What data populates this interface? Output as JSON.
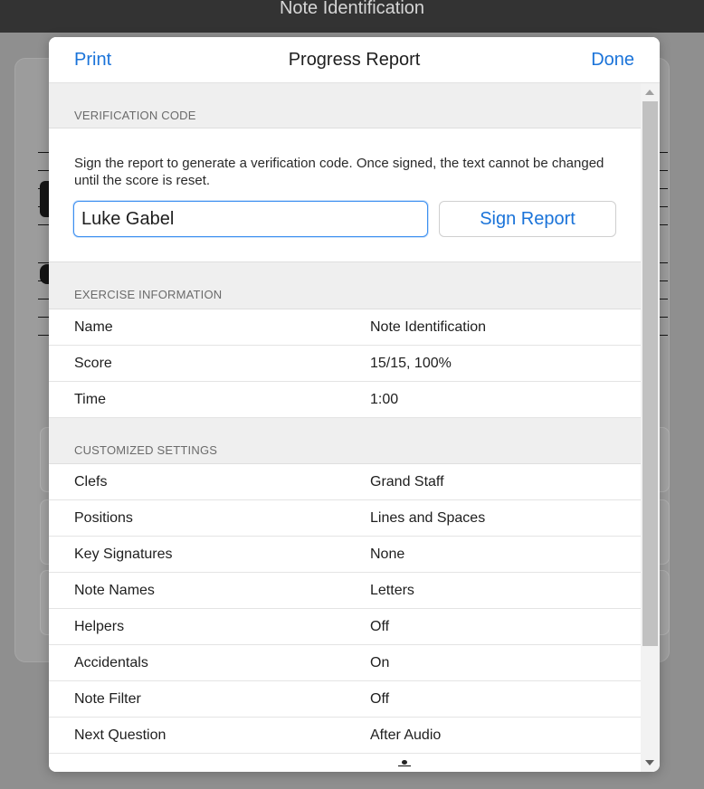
{
  "app": {
    "title": "Note Identification"
  },
  "modal": {
    "print_label": "Print",
    "title": "Progress Report",
    "done_label": "Done"
  },
  "verification": {
    "section_label": "VERIFICATION CODE",
    "instructions": "Sign the report to generate a verification code. Once signed, the text cannot be changed until the score is reset.",
    "name_value": "Luke Gabel",
    "sign_button": "Sign Report"
  },
  "exercise": {
    "section_label": "EXERCISE INFORMATION",
    "rows": [
      {
        "label": "Name",
        "value": "Note Identification"
      },
      {
        "label": "Score",
        "value": "15/15, 100%"
      },
      {
        "label": "Time",
        "value": "1:00"
      }
    ]
  },
  "settings": {
    "section_label": "CUSTOMIZED SETTINGS",
    "rows": [
      {
        "label": "Clefs",
        "value": "Grand Staff"
      },
      {
        "label": "Positions",
        "value": "Lines and Spaces"
      },
      {
        "label": "Key Signatures",
        "value": "None"
      },
      {
        "label": "Note Names",
        "value": "Letters"
      },
      {
        "label": "Helpers",
        "value": "Off"
      },
      {
        "label": "Accidentals",
        "value": "On"
      },
      {
        "label": "Note Filter",
        "value": "Off"
      },
      {
        "label": "Next Question",
        "value": "After Audio"
      }
    ]
  },
  "colors": {
    "accent": "#1a73d9",
    "topbar": "#333333",
    "overlay": "#8f8f8f"
  }
}
